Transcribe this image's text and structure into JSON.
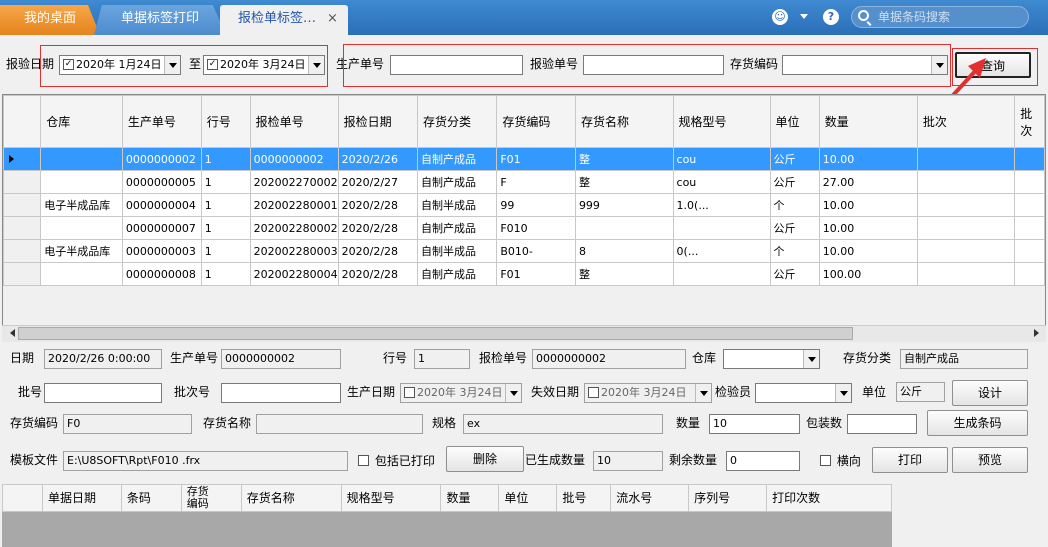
{
  "tabs": [
    {
      "label": "我的桌面"
    },
    {
      "label": "单据标签打印"
    },
    {
      "label": "报检单标签…",
      "close": "×"
    }
  ],
  "topbar": {
    "search_placeholder": "单据条码搜索",
    "help": "?"
  },
  "filter": {
    "date_label": "报验日期",
    "date_from": "2020年  1月24日",
    "to_label": "至",
    "date_to": "2020年  3月24日",
    "prod_no_label": "生产单号",
    "inspect_no_label": "报验单号",
    "inv_code_label": "存货编码",
    "query_button": "查询"
  },
  "grid": {
    "columns": [
      "",
      "仓库",
      "生产单号",
      "行号",
      "报检单号",
      "报检日期",
      "存货分类",
      "存货编码",
      "存货名称",
      "规格型号",
      "单位",
      "数量",
      "批次",
      "批次"
    ],
    "rows": [
      [
        "",
        "0000000002",
        "1",
        "0000000002",
        "2020/2/26",
        "自制产成品",
        "F01",
        "整",
        "cou",
        "公斤",
        "10.00",
        ""
      ],
      [
        "",
        "0000000005",
        "1",
        "202002270002",
        "2020/2/27",
        "自制产成品",
        "F",
        "整",
        "cou",
        "公斤",
        "27.00",
        ""
      ],
      [
        "电子半成品库",
        "0000000004",
        "1",
        "202002280001",
        "2020/2/28",
        "自制半成品",
        "99",
        "999",
        "1.0(...",
        "个",
        "10.00",
        ""
      ],
      [
        "",
        "0000000007",
        "1",
        "202002280002",
        "2020/2/28",
        "自制产成品",
        "F010",
        "",
        "",
        "公斤",
        "10.00",
        ""
      ],
      [
        "电子半成品库",
        "0000000003",
        "1",
        "202002280003",
        "2020/2/28",
        "自制半成品",
        "B010-",
        "8",
        "0(...",
        "个",
        "10.00",
        ""
      ],
      [
        "",
        "0000000008",
        "1",
        "202002280004",
        "2020/2/28",
        "自制产成品",
        "F01",
        "整",
        "",
        "公斤",
        "100.00",
        ""
      ]
    ]
  },
  "detail": {
    "date_label": "日期",
    "date_value": "2020/2/26 0:00:00",
    "prod_no_label": "生产单号",
    "prod_no_value": "0000000002",
    "line_label": "行号",
    "line_value": "1",
    "inspect_no_label": "报检单号",
    "inspect_no_value": "0000000002",
    "warehouse_label": "仓库",
    "category_label": "存货分类",
    "category_value": "自制产成品",
    "batch_label": "批号",
    "batch_seq_label": "批次号",
    "mfg_date_label": "生产日期",
    "mfg_date_value": "2020年  3月24日",
    "exp_date_label": "失效日期",
    "exp_date_value": "2020年  3月24日",
    "inspector_label": "检验员",
    "unit_label": "单位",
    "unit_value": "公斤",
    "design_button": "设计",
    "inv_code_label": "存货编码",
    "inv_code_value": "F0",
    "inv_name_label": "存货名称",
    "inv_name_value": "",
    "spec_label": "规格",
    "spec_value": "ex",
    "qty_label": "数量",
    "qty_value": "10",
    "pack_label": "包装数",
    "gen_barcode_button": "生成条码",
    "template_label": "模板文件",
    "template_value": "E:\\U8SOFT\\Rpt\\F010        .frx",
    "include_printed_label": "包括已打印",
    "delete_button": "删除",
    "generated_label": "已生成数量",
    "generated_value": "10",
    "remaining_label": "剩余数量",
    "remaining_value": "0",
    "landscape_label": "横向",
    "print_button": "打印",
    "preview_button": "预览"
  },
  "bottom_grid": {
    "columns": [
      "",
      "单据日期",
      "条码",
      "存货\n编码",
      "存货名称",
      "规格型号",
      "数量",
      "单位",
      "批号",
      "流水号",
      "序列号",
      "打印次数"
    ]
  },
  "colors": {
    "selected_row": "#3399ff",
    "annotation": "#e03030",
    "topbar": "#2a6fb8",
    "home_tab": "#e5841c"
  }
}
